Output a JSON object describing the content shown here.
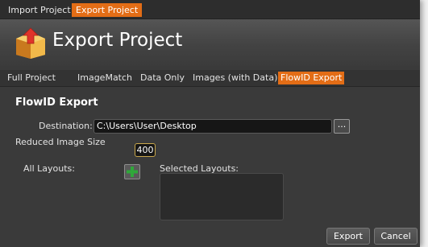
{
  "top_tabs": [
    {
      "label": "Import Project",
      "active": false
    },
    {
      "label": "Export Project",
      "active": true
    }
  ],
  "header": {
    "title": "Export Project",
    "logo_icon": "folder-with-up-arrow-icon"
  },
  "sub_tabs": [
    {
      "label": "Full Project",
      "active": false
    },
    {
      "label": "ImageMatch",
      "active": false
    },
    {
      "label": "Data Only",
      "active": false
    },
    {
      "label": "Images (with Data)",
      "active": false
    },
    {
      "label": "FlowID Export",
      "active": true
    }
  ],
  "form": {
    "section_title": "FlowID Export",
    "destination_label": "Destination:",
    "destination_value": "C:\\Users\\User\\Desktop",
    "browse_label": "...",
    "reduced_size_label": "Reduced Image Size",
    "reduced_size_value": "400",
    "all_layouts_label": "All Layouts:",
    "selected_layouts_label": "Selected Layouts:",
    "selected_layouts": []
  },
  "buttons": {
    "export": "Export",
    "cancel": "Cancel"
  },
  "colors": {
    "accent": "#e36d16",
    "background": "#3a3a3a",
    "add_icon": "#2fa83a"
  }
}
